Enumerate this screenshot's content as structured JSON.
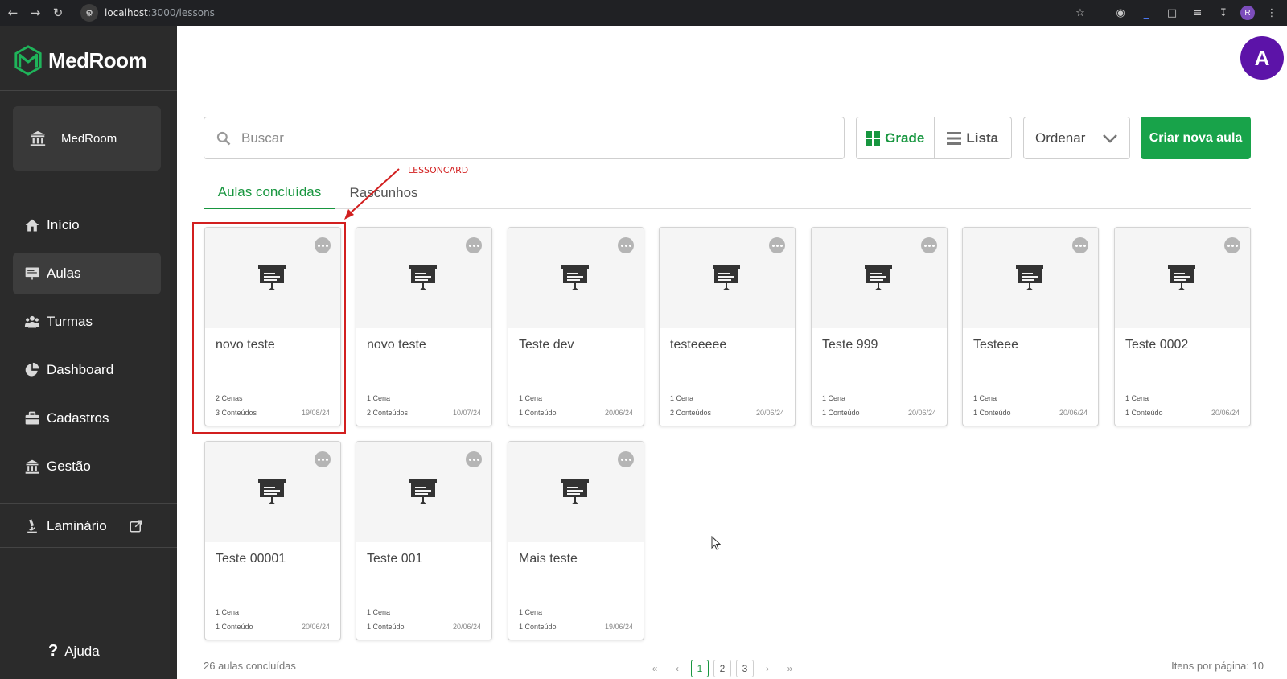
{
  "browser": {
    "url_host": "localhost",
    "url_path": ":3000/lessons",
    "profile_initial": "R"
  },
  "sidebar": {
    "logo_text": "MedRoom",
    "org_label": "MedRoom",
    "items": [
      {
        "label": "Início",
        "icon": "home-icon"
      },
      {
        "label": "Aulas",
        "icon": "presentation-icon"
      },
      {
        "label": "Turmas",
        "icon": "users-icon"
      },
      {
        "label": "Dashboard",
        "icon": "pie-chart-icon"
      },
      {
        "label": "Cadastros",
        "icon": "briefcase-icon"
      },
      {
        "label": "Gestão",
        "icon": "bank-icon"
      }
    ],
    "laminario_label": "Laminário",
    "help_label": "Ajuda"
  },
  "header": {
    "avatar_initial": "A",
    "avatar_color": "#5c13a8"
  },
  "toolbar": {
    "search_placeholder": "Buscar",
    "grid_label": "Grade",
    "list_label": "Lista",
    "sort_label": "Ordenar",
    "create_label": "Criar nova aula",
    "accent_color": "#18a34a"
  },
  "tabs": {
    "completed": "Aulas concluídas",
    "drafts": "Rascunhos"
  },
  "annotation": {
    "label": "LESSONCARD"
  },
  "lessons": [
    {
      "title": "novo teste",
      "scenes": "2 Cenas",
      "contents": "3 Conteúdos",
      "date": "19/08/24"
    },
    {
      "title": "novo teste",
      "scenes": "1 Cena",
      "contents": "2 Conteúdos",
      "date": "10/07/24"
    },
    {
      "title": "Teste dev",
      "scenes": "1 Cena",
      "contents": "1 Conteúdo",
      "date": "20/06/24"
    },
    {
      "title": "testeeeee",
      "scenes": "1 Cena",
      "contents": "2 Conteúdos",
      "date": "20/06/24"
    },
    {
      "title": "Teste 999",
      "scenes": "1 Cena",
      "contents": "1 Conteúdo",
      "date": "20/06/24"
    },
    {
      "title": "Testeee",
      "scenes": "1 Cena",
      "contents": "1 Conteúdo",
      "date": "20/06/24"
    },
    {
      "title": "Teste 0002",
      "scenes": "1 Cena",
      "contents": "1 Conteúdo",
      "date": "20/06/24"
    },
    {
      "title": "Teste 00001",
      "scenes": "1 Cena",
      "contents": "1 Conteúdo",
      "date": "20/06/24"
    },
    {
      "title": "Teste 001",
      "scenes": "1 Cena",
      "contents": "1 Conteúdo",
      "date": "20/06/24"
    },
    {
      "title": "Mais teste",
      "scenes": "1 Cena",
      "contents": "1 Conteúdo",
      "date": "19/06/24"
    }
  ],
  "footer": {
    "count_text": "26 aulas concluídas",
    "pages": [
      "1",
      "2",
      "3"
    ],
    "current_page": "1",
    "per_page_text": "Itens por página:  10"
  }
}
